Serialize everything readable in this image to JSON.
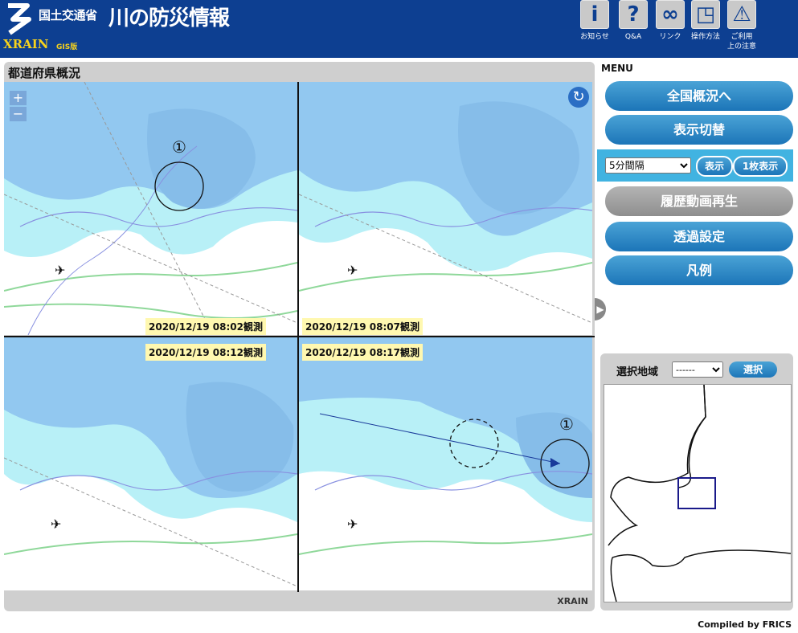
{
  "header": {
    "ministry": "国土交通省",
    "title": "川の防災情報",
    "xrain": "XRAIN",
    "gis": "GIS版",
    "buttons": [
      {
        "label": "お知らせ",
        "icon": "info-icon",
        "glyph": "i"
      },
      {
        "label": "Q&A",
        "icon": "question-icon",
        "glyph": "?"
      },
      {
        "label": "リンク",
        "icon": "link-icon",
        "glyph": "∞"
      },
      {
        "label": "操作方法",
        "icon": "mouse-icon",
        "glyph": "◳"
      },
      {
        "label": "ご利用\n上の注意",
        "icon": "warning-icon",
        "glyph": "⚠"
      }
    ]
  },
  "panel": {
    "title": "都道府県概況",
    "zoom_in": "+",
    "zoom_out": "−",
    "footer": "XRAIN",
    "maps": [
      {
        "timestamp": "2020/12/19 08:02観測",
        "marker": "①"
      },
      {
        "timestamp": "2020/12/19 08:07観測"
      },
      {
        "timestamp": "2020/12/19 08:12観測"
      },
      {
        "timestamp": "2020/12/19 08:17観測",
        "marker": "①"
      }
    ]
  },
  "menu": {
    "title": "MENU",
    "nationwide": "全国概況へ",
    "display_toggle": "表示切替",
    "interval_value": "5分間隔",
    "show": "表示",
    "single": "1枚表示",
    "history": "履歴動画再生",
    "transparency": "透過設定",
    "legend": "凡例"
  },
  "region": {
    "label": "選択地域",
    "select_value": "------",
    "button": "選択"
  },
  "footer": {
    "compiled": "Compiled by FRICS"
  },
  "colors": {
    "header_bg": "#0d3f91",
    "accent_yellow": "#f7d21c",
    "button_blue": "#1c75b8",
    "rain_light": "#b8f0f7",
    "rain_medium": "#92c8f0"
  }
}
